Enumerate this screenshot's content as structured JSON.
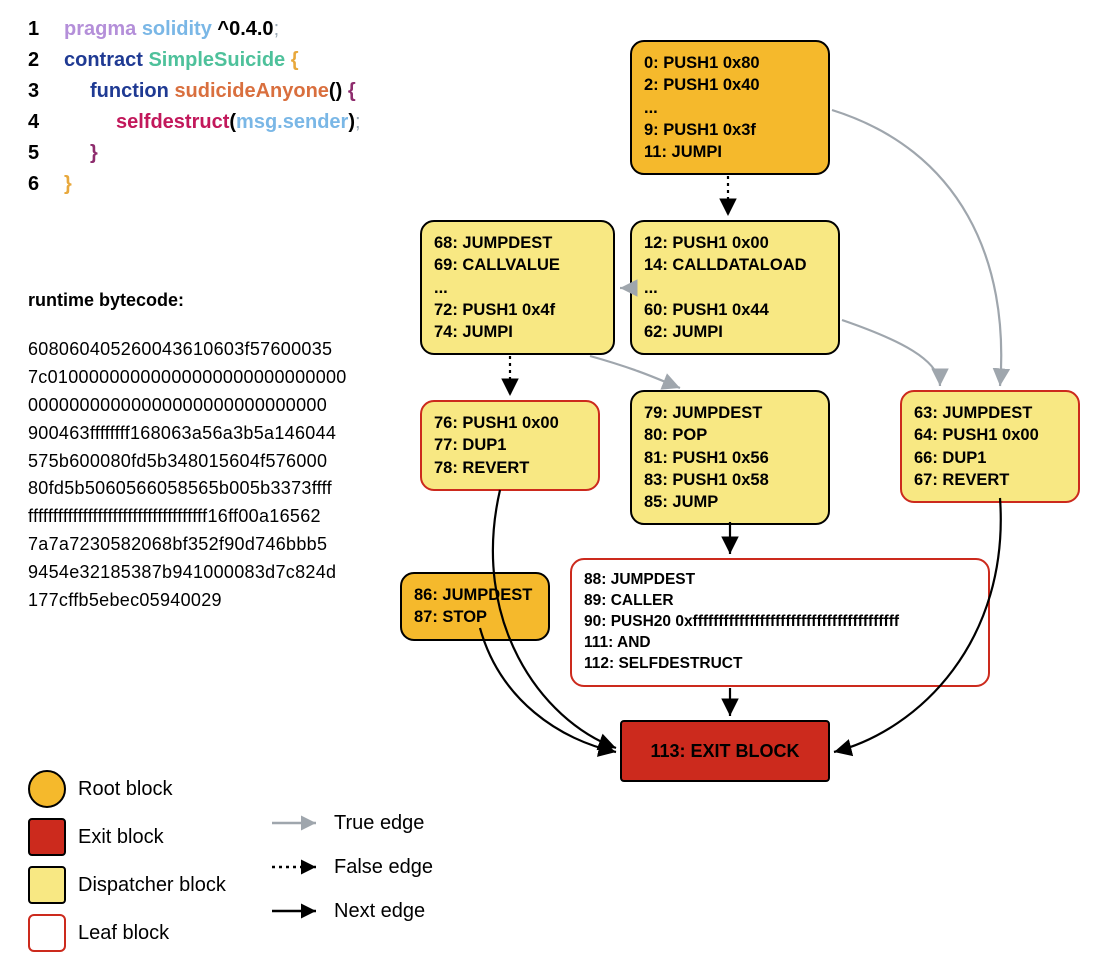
{
  "code": {
    "l1": {
      "num": "1",
      "pragma": "pragma",
      "solidity": "solidity",
      "version": "^0.4.0",
      "semi": ";"
    },
    "l2": {
      "num": "2",
      "contract": "contract",
      "name": "SimpleSuicide",
      "brace": "{"
    },
    "l3": {
      "num": "3",
      "function": "function",
      "fn": "sudicideAnyone",
      "parens": "()",
      "brace": "{"
    },
    "l4": {
      "num": "4",
      "self": "selfdestruct",
      "open": "(",
      "msg": "msg.sender",
      "close": ")",
      "semi": ";"
    },
    "l5": {
      "num": "5",
      "brace": "}"
    },
    "l6": {
      "num": "6",
      "brace": "}"
    }
  },
  "bytecode": {
    "title": "runtime bytecode:",
    "lines": [
      "608060405260043610603f57600035",
      "7c01000000000000000000000000000",
      "00000000000000000000000000000",
      "900463ffffffff168063a56a3b5a146044",
      "575b600080fd5b348015604f576000",
      "80fd5b5060566058565b005b3373ffff",
      "ffffffffffffffffffffffffffffffffffff16ff00a16562",
      "7a7a7230582068bf352f90d746bbb5",
      "9454e32185387b941000083d7c824d",
      "177cffb5ebec05940029"
    ]
  },
  "blocks": {
    "b0": [
      "0: PUSH1 0x80",
      "2: PUSH1 0x40",
      "...",
      "9: PUSH1 0x3f",
      "11: JUMPI"
    ],
    "b12": [
      "12: PUSH1 0x00",
      "14: CALLDATALOAD",
      "...",
      "60: PUSH1 0x44",
      "62: JUMPI"
    ],
    "b68": [
      "68: JUMPDEST",
      "69: CALLVALUE",
      "...",
      "72: PUSH1 0x4f",
      "74: JUMPI"
    ],
    "b76": [
      "76: PUSH1 0x00",
      "77: DUP1",
      "78: REVERT"
    ],
    "b79": [
      "79: JUMPDEST",
      "80: POP",
      "81: PUSH1 0x56",
      "83: PUSH1 0x58",
      "85: JUMP"
    ],
    "b63": [
      "63: JUMPDEST",
      "64: PUSH1 0x00",
      "66: DUP1",
      "67: REVERT"
    ],
    "b86": [
      "86: JUMPDEST",
      "87: STOP"
    ],
    "b88": [
      "88: JUMPDEST",
      "89: CALLER",
      "90: PUSH20 0xffffffffffffffffffffffffffffffffffffffff",
      "111: AND",
      "112: SELFDESTRUCT"
    ],
    "exit": "113: EXIT BLOCK"
  },
  "legend": {
    "root": "Root block",
    "exit": "Exit block",
    "disp": "Dispatcher block",
    "leaf": "Leaf block",
    "true": "True edge",
    "false": "False edge",
    "next": "Next edge"
  }
}
